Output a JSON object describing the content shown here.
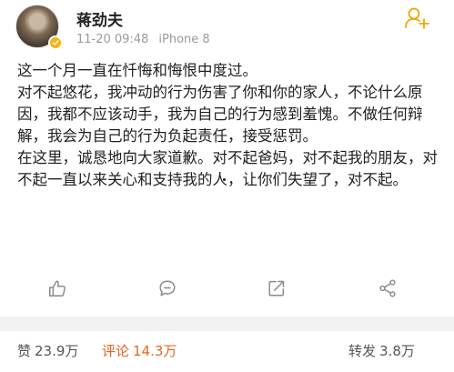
{
  "user": {
    "name": "蒋劲夫",
    "time": "11-20 09:48",
    "device": "iPhone 8"
  },
  "post": {
    "paragraphs": [
      "这一个月一直在忏悔和悔恨中度过。",
      "对不起悠花，我冲动的行为伤害了你和你的家人，不论什么原因，我都不应该动手，我为自己的行为感到羞愧。不做任何辩解，我会为自己的行为负起责任，接受惩罚。",
      "在这里，诚恳地向大家道歉。对不起爸妈，对不起我的朋友，对不起一直以来关心和支持我的人，让你们失望了，对不起。"
    ]
  },
  "icons": {
    "follow": "add-user-icon",
    "like": "thumbs-up-icon",
    "comment": "comment-icon",
    "repost": "repost-icon",
    "share": "share-icon"
  },
  "stats": {
    "likes_label": "赞",
    "likes_count": "23.9万",
    "comments_label": "评论",
    "comments_count": "14.3万",
    "reposts_label": "转发",
    "reposts_count": "3.8万"
  },
  "colors": {
    "accent": "#f5b40f",
    "comment_active": "#e8631b",
    "icon_gray": "#888888"
  }
}
